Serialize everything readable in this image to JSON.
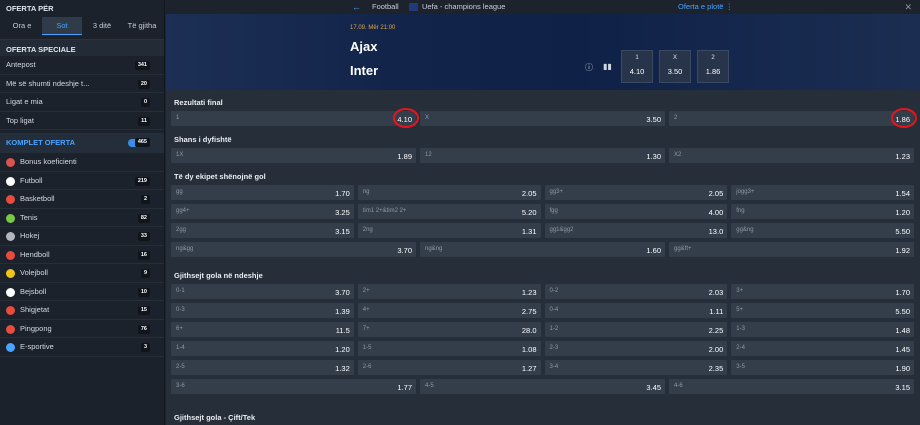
{
  "sidebar": {
    "header": "OFERTA PËR",
    "tabs": [
      "Ora e",
      "Sot",
      "3 ditë",
      "Të gjitha"
    ],
    "active_tab": "Sot",
    "special_title": "OFERTA SPECIALE",
    "special": [
      {
        "label": "Antepost",
        "count": "341"
      },
      {
        "label": "Më së shumti ndeshje t...",
        "count": "20"
      },
      {
        "label": "Ligat e mia",
        "count": "0"
      },
      {
        "label": "Top ligat",
        "count": "11"
      }
    ],
    "komplet": {
      "label": "KOMPLET OFERTA",
      "count": "465"
    },
    "sports": [
      {
        "label": "Bonus koeficienti",
        "icon": "bonus-icon",
        "color": "#d9534f",
        "count": ""
      },
      {
        "label": "Futboll",
        "icon": "football-icon",
        "color": "#ffffff",
        "count": "219"
      },
      {
        "label": "Basketboll",
        "icon": "basketball-icon",
        "color": "#e94b3c",
        "count": "2"
      },
      {
        "label": "Tenis",
        "icon": "tennis-icon",
        "color": "#7ac943",
        "count": "82"
      },
      {
        "label": "Hokej",
        "icon": "hockey-icon",
        "color": "#b0b6bd",
        "count": "33"
      },
      {
        "label": "Hendboll",
        "icon": "handball-icon",
        "color": "#e94b3c",
        "count": "16"
      },
      {
        "label": "Volejboll",
        "icon": "volleyball-icon",
        "color": "#f0c419",
        "count": "9"
      },
      {
        "label": "Bejsboll",
        "icon": "baseball-icon",
        "color": "#ffffff",
        "count": "10"
      },
      {
        "label": "Shigjetat",
        "icon": "darts-icon",
        "color": "#e94b3c",
        "count": "15"
      },
      {
        "label": "Pingpong",
        "icon": "pingpong-icon",
        "color": "#e94b3c",
        "count": "76"
      },
      {
        "label": "E-sportive",
        "icon": "esports-icon",
        "color": "#4aa3ff",
        "count": "3"
      }
    ]
  },
  "topbar": {
    "sport": "Football",
    "league": "Uefa - champions league",
    "full_offer": "Oferta e plotë ⋮"
  },
  "event": {
    "datetime": "17.09. Mër 21:00",
    "home": "Ajax",
    "away": "Inter",
    "odds": [
      {
        "label": "1",
        "value": "4.10"
      },
      {
        "label": "X",
        "value": "3.50"
      },
      {
        "label": "2",
        "value": "1.86"
      }
    ]
  },
  "markets": [
    {
      "title": "Rezultati final",
      "rows": [
        [
          [
            "1",
            "4.10"
          ],
          [
            "X",
            "3.50"
          ],
          [
            "2",
            "1.86"
          ]
        ]
      ]
    },
    {
      "title": "Shans i dyfishtë",
      "rows": [
        [
          [
            "1X",
            "1.89"
          ],
          [
            "12",
            "1.30"
          ],
          [
            "X2",
            "1.23"
          ]
        ]
      ]
    },
    {
      "title": "Të dy ekipet shënojnë gol",
      "rows": [
        [
          [
            "gg",
            "1.70"
          ],
          [
            "ng",
            "2.05"
          ],
          [
            "gg3+",
            "2.05"
          ],
          [
            "jogg3+",
            "1.54"
          ]
        ],
        [
          [
            "gg4+",
            "3.25"
          ],
          [
            "tim1 2+&tim2 2+",
            "5.20"
          ],
          [
            "fgg",
            "4.00"
          ],
          [
            "fng",
            "1.20"
          ]
        ],
        [
          [
            "2gg",
            "3.15"
          ],
          [
            "2ng",
            "1.31"
          ],
          [
            "gg1&gg2",
            "13.0"
          ],
          [
            "gg&ng",
            "5.50"
          ]
        ],
        [
          [
            "ng&gg",
            "3.70"
          ],
          [
            "ng&ng",
            "1.60"
          ],
          [
            "gg&ft+",
            "1.92"
          ]
        ]
      ]
    },
    {
      "title": "Gjithsejt gola në ndeshje",
      "rows": [
        [
          [
            "0-1",
            "3.70"
          ],
          [
            "2+",
            "1.23"
          ],
          [
            "0-2",
            "2.03"
          ],
          [
            "3+",
            "1.70"
          ]
        ],
        [
          [
            "0-3",
            "1.39"
          ],
          [
            "4+",
            "2.75"
          ],
          [
            "0-4",
            "1.11"
          ],
          [
            "5+",
            "5.50"
          ]
        ],
        [
          [
            "6+",
            "11.5"
          ],
          [
            "7+",
            "28.0"
          ],
          [
            "1-2",
            "2.25"
          ],
          [
            "1-3",
            "1.48"
          ]
        ],
        [
          [
            "1-4",
            "1.20"
          ],
          [
            "1-5",
            "1.08"
          ],
          [
            "2-3",
            "2.00"
          ],
          [
            "2-4",
            "1.45"
          ]
        ],
        [
          [
            "2-5",
            "1.32"
          ],
          [
            "2-6",
            "1.27"
          ],
          [
            "3-4",
            "2.35"
          ],
          [
            "3-5",
            "1.90"
          ]
        ],
        [
          [
            "3-6",
            "1.77"
          ],
          [
            "4-5",
            "3.45"
          ],
          [
            "4-6",
            "3.15"
          ]
        ]
      ]
    },
    {
      "title": "Gjithsejt gola - Çift/Tek",
      "rows": []
    }
  ]
}
